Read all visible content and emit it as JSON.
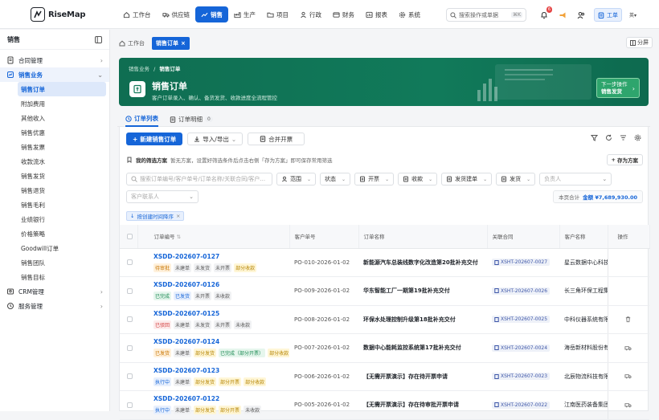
{
  "app": {
    "name": "RiseMap"
  },
  "nav": [
    {
      "label": "工作台",
      "icon": "home-icon",
      "active": false
    },
    {
      "label": "供应链",
      "icon": "supply-chain-icon",
      "active": false
    },
    {
      "label": "销售",
      "icon": "trend-icon",
      "active": true
    },
    {
      "label": "生产",
      "icon": "factory-icon",
      "active": false
    },
    {
      "label": "项目",
      "icon": "folder-icon",
      "active": false
    },
    {
      "label": "行政",
      "icon": "people-icon",
      "active": false
    },
    {
      "label": "财务",
      "icon": "finance-icon",
      "active": false
    },
    {
      "label": "报表",
      "icon": "report-icon",
      "active": false
    },
    {
      "label": "系统",
      "icon": "gear-icon",
      "active": false
    }
  ],
  "search": {
    "placeholder": "搜索操作或单据",
    "shortcut": "⌘K"
  },
  "header": {
    "notification_count": "6",
    "work_label": "工单",
    "lang_label": "英"
  },
  "sidebar": {
    "title": "销售",
    "groups": [
      {
        "label": "合同管理",
        "icon": "contract-icon",
        "expanded": false,
        "items": []
      },
      {
        "label": "销售业务",
        "icon": "sales-icon",
        "expanded": true,
        "items": [
          "销售订单",
          "附加费用",
          "其他收入",
          "销售优惠",
          "销售发票",
          "收款流水",
          "销售发货",
          "销售退货",
          "销售毛利",
          "业绩银行",
          "价格策略",
          "Goodwill订单",
          "销售团队",
          "销售目标"
        ]
      },
      {
        "label": "CRM管理",
        "icon": "crm-icon",
        "expanded": false,
        "items": []
      },
      {
        "label": "服务管理",
        "icon": "service-icon",
        "expanded": false,
        "items": []
      }
    ],
    "active_item": "销售订单"
  },
  "page_tabs": [
    {
      "label": "工作台",
      "active": false
    },
    {
      "label": "销售订单",
      "active": true,
      "closable": "×"
    }
  ],
  "share_label": "分屏",
  "hero": {
    "crumb_parent": "销售业务",
    "crumb_current": "销售订单",
    "title": "销售订单",
    "subtitle": "客户订单录入、确认、备货发货、收款进度全流程管控",
    "next_top": "下一步操作",
    "next_bottom": "销售发货"
  },
  "sub_tabs": [
    {
      "label": "订单列表",
      "active": true,
      "count": ""
    },
    {
      "label": "订单明细",
      "active": false,
      "count": "0"
    }
  ],
  "toolbar": {
    "new_label": "新建销售订单",
    "import_label": "导入/导出",
    "merge_label": "合并开票"
  },
  "scheme": {
    "label": "我的筛选方案",
    "hint": "暂无方案，设置好筛选条件后点击右侧「存为方案」即可保存常用筛选",
    "save_label": "存为方案"
  },
  "filters": {
    "search_placeholder": "搜索订单编号/客户单号/订单名称/关联合同/客户...",
    "selects": [
      "范围",
      "状态",
      "开票",
      "收款",
      "发货建单",
      "发货"
    ],
    "owner_placeholder": "负责人",
    "contact_placeholder": "客户联系人"
  },
  "total": {
    "label": "本页合计",
    "amount": "金额 ¥7,689,930.00"
  },
  "sort_tag": "按创建时间降序",
  "table": {
    "headers": [
      "订单编号",
      "客户单号",
      "订单名称",
      "关联合同",
      "客户名称",
      "操作"
    ],
    "rows": [
      {
        "no": "XSDD-202607-0127",
        "tags": [
          [
            "待审批",
            "t-orange"
          ],
          [
            "未建单",
            "t-gray"
          ],
          [
            "未发货",
            "t-gray"
          ],
          [
            "未开票",
            "t-gray"
          ],
          [
            "部分收款",
            "t-yellow"
          ]
        ],
        "po": "PO-010-2026-01-02",
        "name": "新能源汽车总装线数字化改造第20批补充交付",
        "contract": "XSHT-202607-0027",
        "customer": "星云数据中心科技",
        "op": ""
      },
      {
        "no": "XSDD-202607-0126",
        "tags": [
          [
            "已完成",
            "t-green"
          ],
          [
            "已发货",
            "t-blue"
          ],
          [
            "未开票",
            "t-gray"
          ],
          [
            "未收款",
            "t-gray"
          ]
        ],
        "po": "PO-009-2026-01-02",
        "name": "华东智能工厂一期第19批补充交付",
        "contract": "XSHT-202607-0026",
        "customer": "长三角环保工程集团",
        "op": ""
      },
      {
        "no": "XSDD-202607-0125",
        "tags": [
          [
            "已驳回",
            "t-red"
          ],
          [
            "未建单",
            "t-gray"
          ],
          [
            "未发货",
            "t-gray"
          ],
          [
            "未开票",
            "t-gray"
          ],
          [
            "未收款",
            "t-gray"
          ]
        ],
        "po": "PO-008-2026-01-02",
        "name": "环保水处理控制升级第18批补充交付",
        "contract": "XSHT-202607-0025",
        "customer": "中科仪器系统有限公司",
        "op": "trash-icon"
      },
      {
        "no": "XSDD-202607-0124",
        "tags": [
          [
            "已发货",
            "t-orange"
          ],
          [
            "未建单",
            "t-gray"
          ],
          [
            "部分发货",
            "t-yellow"
          ],
          [
            "已完成（部分开票）",
            "t-green"
          ],
          [
            "部分收款",
            "t-yellow"
          ]
        ],
        "po": "PO-007-2026-01-02",
        "name": "数据中心能耗监控系统第17批补充交付",
        "contract": "XSHT-202607-0024",
        "customer": "海岳新材料股份有限公司",
        "op": "truck-icon"
      },
      {
        "no": "XSDD-202607-0123",
        "tags": [
          [
            "执行中",
            "t-blue"
          ],
          [
            "未建单",
            "t-gray"
          ],
          [
            "部分发货",
            "t-yellow"
          ],
          [
            "部分开票",
            "t-yellow"
          ],
          [
            "部分收款",
            "t-yellow"
          ]
        ],
        "po": "PO-006-2026-01-02",
        "name": "【无需开票演示】存在待开票申请",
        "contract": "XSHT-202607-0023",
        "customer": "北辰物流科技有限公司",
        "op": "truck-icon"
      },
      {
        "no": "XSDD-202607-0122",
        "tags": [
          [
            "执行中",
            "t-blue"
          ],
          [
            "未建单",
            "t-gray"
          ],
          [
            "部分发货",
            "t-yellow"
          ],
          [
            "部分开票",
            "t-yellow"
          ],
          [
            "未收款",
            "t-gray"
          ]
        ],
        "po": "PO-005-2026-01-02",
        "name": "【无需开票演示】存在待审批开票申请",
        "contract": "XSHT-202607-0022",
        "customer": "江南医药装备集团",
        "op": "truck-icon"
      }
    ]
  },
  "colors": {
    "accent": "#1565d8",
    "hero": "#117a5a",
    "hero_button": "#2ea56d"
  }
}
